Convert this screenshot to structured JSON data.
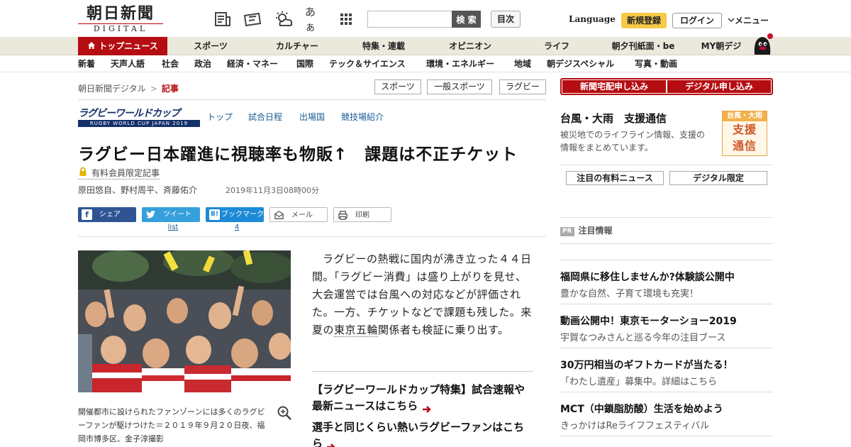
{
  "header": {
    "logo_main": "朝日新聞",
    "logo_sub": "DIGITAL",
    "icon_kana": "あぁ",
    "search_placeholder": "",
    "search_button": "検 索",
    "toc_button": "目次",
    "language": "Language",
    "signup": "新規登録",
    "login": "ログイン",
    "menu": "メニュー"
  },
  "nav": [
    {
      "label": "トップニュース",
      "active": true
    },
    {
      "label": "スポーツ"
    },
    {
      "label": "カルチャー"
    },
    {
      "label": "特集・連載"
    },
    {
      "label": "オピニオン"
    },
    {
      "label": "ライフ"
    },
    {
      "label": "朝夕刊紙面・be"
    },
    {
      "label": "MY朝デジ"
    }
  ],
  "subnav": [
    "新着",
    "天声人語",
    "社会",
    "政治",
    "経済・マネー",
    "国際",
    "テック＆サイエンス",
    "環境・エネルギー",
    "地域",
    "朝デジスペシャル",
    "写真・動画"
  ],
  "breadcrumb": {
    "root": "朝日新聞デジタル",
    "sep": ">",
    "current": "記事"
  },
  "tags": [
    "スポーツ",
    "一般スポーツ",
    "ラグビー"
  ],
  "rwc": {
    "title": "ラグビーワールドカップ",
    "subtitle": "RUGBY WORLD CUP JAPAN 2019",
    "links": [
      "トップ",
      "試合日程",
      "出場国",
      "競技場紹介"
    ]
  },
  "article": {
    "title": "ラグビー日本躍進に視聴率も物販↑　課題は不正チケット",
    "paid_label": "有料会員限定記事",
    "authors": "原田悠自、野村周平、斉藤佑介",
    "date": "2019年11月3日08時00分",
    "share": {
      "facebook": "シェア",
      "twitter": "ツイート",
      "hatena": "ブックマーク",
      "mail": "メール",
      "print": "印刷",
      "twitter_count": "list",
      "hatena_count": "4"
    },
    "caption": "開催都市に設けられたファンゾーンには多くのラグビーファンが駆けつけた＝２０１９年９月２０日夜、福岡市博多区、金子淳撮影",
    "lead_a": "ラグビーの熱戦に国内が沸き立った４４日間。「ラグビー消費」は盛り上がりを見せ、大会運営では台風への対応などが評価された。一方、チケットなどで課題も残した。来夏の",
    "lead_kw": "東京五輪",
    "lead_b": "関係者も検証に乗り出す。",
    "links": [
      "【ラグビーワールドカップ特集】試合速報や最新ニュースはこちら",
      "選手と同じくらい熱いラグビーファンはこちら"
    ]
  },
  "side": {
    "apply_home": "新聞宅配申し込み",
    "apply_digital": "デジタル申し込み",
    "typhoon_title": "台風・大雨　支援通信",
    "typhoon_desc": "被災地でのライフライン情報、支援の情報をまとめています。",
    "typhoon_badge_top": "台風・大雨",
    "typhoon_badge_l1": "支援",
    "typhoon_badge_l2": "通信",
    "box_paid": "注目の有料ニュース",
    "box_digital": "デジタル限定",
    "pr_badge": "PR",
    "pr_head": "注目情報",
    "pr": [
      {
        "title": "福岡県に移住しませんか?体験談公開中",
        "sub": "豊かな自然、子育て環境も充実！"
      },
      {
        "title": "動画公開中！東京モーターショー2019",
        "sub": "宇賀なつみさんと巡る今年の注目ブース"
      },
      {
        "title": "30万円相当のギフトカードが当たる！",
        "sub": "「わたし遺産」募集中。詳細はこちら"
      },
      {
        "title": "MCT（中鎖脂肪酸）生活を始めよう",
        "sub": "きっかけはReライフフェスティバル"
      }
    ]
  },
  "colors": {
    "brand_red": "#b50d12",
    "nav_bg": "#ebe8dc",
    "link_blue": "#1a5a96",
    "signup_yellow": "#f6c948"
  }
}
